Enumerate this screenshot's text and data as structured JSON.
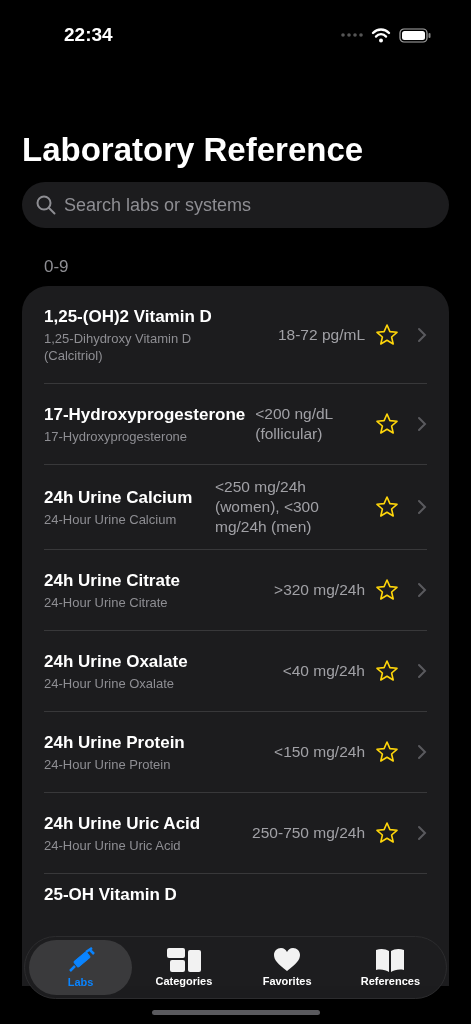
{
  "status_bar": {
    "time": "22:34"
  },
  "title": "Laboratory Reference",
  "search": {
    "placeholder": "Search labs or systems"
  },
  "section": "0-9",
  "labs": [
    {
      "name": "1,25-(OH)2 Vitamin D",
      "full_name": "1,25-Dihydroxy Vitamin D (Calcitriol)",
      "range": "18-72 pg/mL",
      "favorite": false
    },
    {
      "name": "17-Hydroxyprogesterone",
      "full_name": "17-Hydroxyprogesterone",
      "range": "<200 ng/dL (follicular)",
      "favorite": false
    },
    {
      "name": "24h Urine Calcium",
      "full_name": "24-Hour Urine Calcium",
      "range": "<250 mg/24h (women), <300 mg/24h (men)",
      "favorite": false
    },
    {
      "name": "24h Urine Citrate",
      "full_name": "24-Hour Urine Citrate",
      "range": ">320 mg/24h",
      "favorite": false
    },
    {
      "name": "24h Urine Oxalate",
      "full_name": "24-Hour Urine Oxalate",
      "range": "<40 mg/24h",
      "favorite": false
    },
    {
      "name": "24h Urine Protein",
      "full_name": "24-Hour Urine Protein",
      "range": "<150 mg/24h",
      "favorite": false
    },
    {
      "name": "24h Urine Uric Acid",
      "full_name": "24-Hour Urine Uric Acid",
      "range": "250-750 mg/24h",
      "favorite": false
    },
    {
      "name": "25-OH Vitamin D"
    }
  ],
  "tabs": [
    {
      "kind": "syringe",
      "label": "Labs",
      "selected": true
    },
    {
      "kind": "grid",
      "label": "Categories",
      "selected": false
    },
    {
      "kind": "heart",
      "label": "Favorites",
      "selected": false
    },
    {
      "kind": "book",
      "label": "References",
      "selected": false
    }
  ]
}
